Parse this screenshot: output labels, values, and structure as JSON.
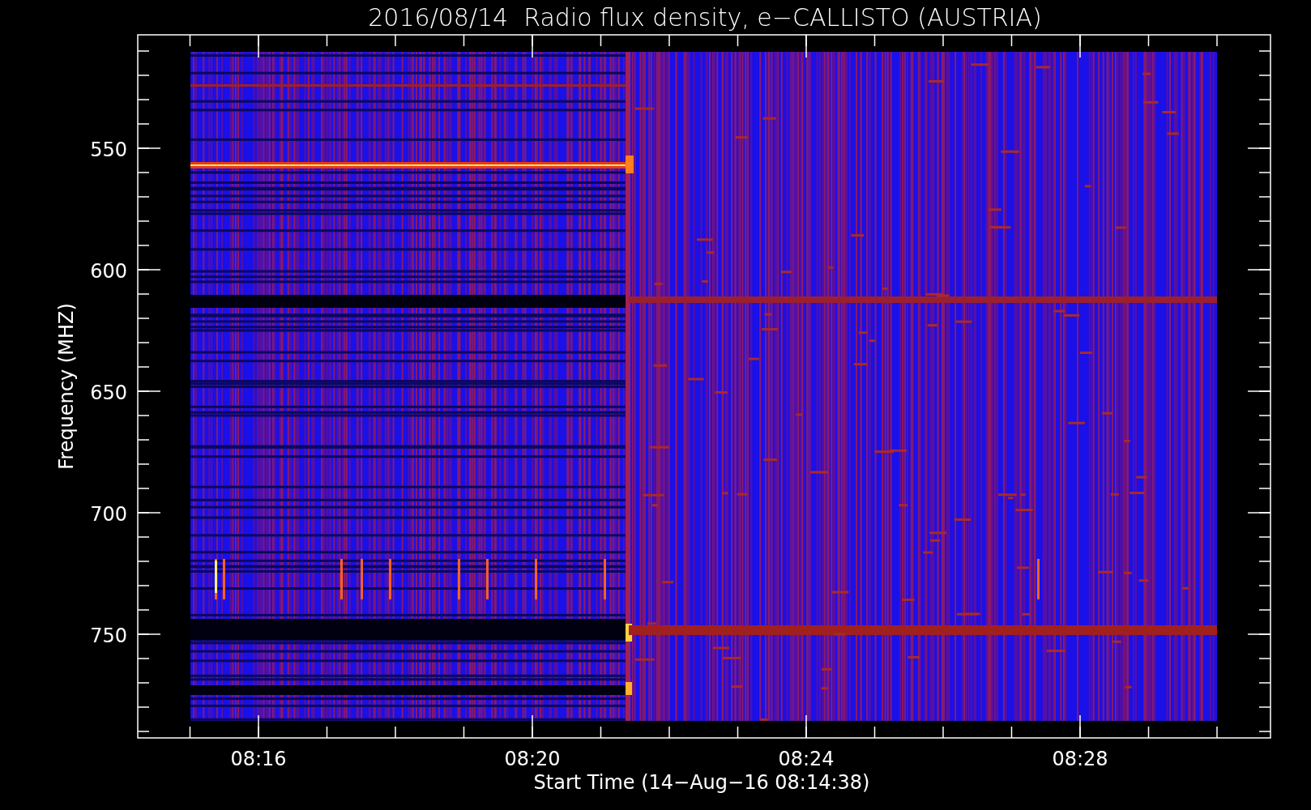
{
  "chart": {
    "title": "2016/08/14  Radio flux density, e−CALLISTO (AUSTRIA)",
    "x_axis": {
      "label": "Start Time (14−Aug−16 08:14:38)",
      "ticks": [
        "08:16",
        "08:20",
        "08:24",
        "08:28"
      ]
    },
    "y_axis": {
      "label": "Frequency (MHZ)",
      "ticks": [
        "550",
        "600",
        "650",
        "700",
        "750"
      ]
    }
  }
}
